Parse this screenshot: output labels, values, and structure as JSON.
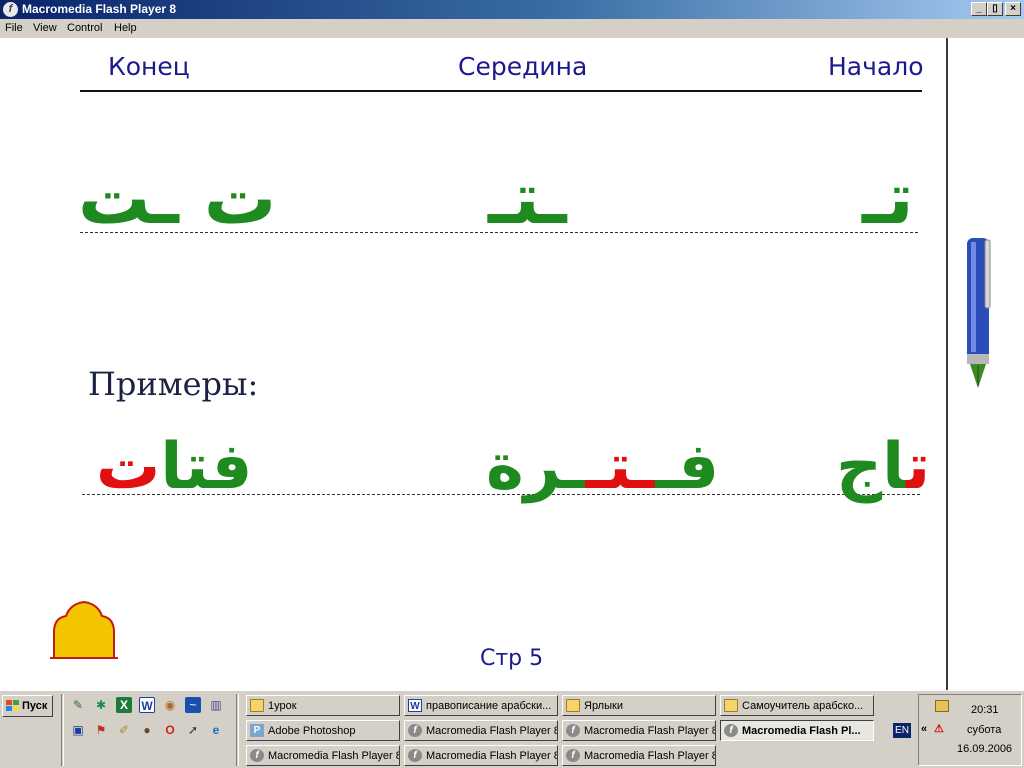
{
  "window": {
    "title": "Macromedia Flash Player 8",
    "app_icon": "flash-player-icon",
    "controls": {
      "minimize": "_",
      "maximize": "▯",
      "close": "×"
    }
  },
  "menu": {
    "items": [
      "File",
      "View",
      "Control",
      "Help"
    ]
  },
  "lesson": {
    "headers": {
      "end": "Конец",
      "middle": "Середина",
      "start": "Начало"
    },
    "letter_forms": {
      "end": "ت ـت",
      "middle": "ـتـ",
      "start": "تـ"
    },
    "examples_label": "Примеры:",
    "examples": {
      "left": {
        "red_part": "ت",
        "green_part": "فتا"
      },
      "middle": {
        "green_a": "فـ",
        "red_part": "ـتـ",
        "green_b": "ـرة"
      },
      "right": {
        "red_part": "ت",
        "green_part": "اج"
      }
    },
    "page": "Стр 5",
    "decor_icons": [
      "pen-icon",
      "mosque-arch-icon"
    ],
    "colors": {
      "heading": "#1a1a8e",
      "arabic_green": "#1f8a1f",
      "highlight_red": "#e01010"
    }
  },
  "taskbar": {
    "start_label": "Пуск",
    "quicklaunch_icons": [
      "pen-icon",
      "star-icon",
      "excel-icon",
      "word-icon",
      "explorer-icon",
      "chart-icon",
      "calculator-icon",
      "floppy-icon",
      "pdf-icon",
      "brush-icon",
      "ball-icon",
      "opera-icon",
      "cursor-icon",
      "ie-icon"
    ],
    "buttons": [
      {
        "label": "1урок",
        "icon": "folder-icon",
        "active": false
      },
      {
        "label": "правописание арабски...",
        "icon": "word-icon",
        "active": false
      },
      {
        "label": "Ярлыки",
        "icon": "folder-icon",
        "active": false
      },
      {
        "label": "Самоучитель арабско...",
        "icon": "folder-icon",
        "active": false
      },
      {
        "label": "Adobe Photoshop",
        "icon": "photoshop-icon",
        "active": false
      },
      {
        "label": "Macromedia Flash Player 8",
        "icon": "flash-icon",
        "active": false
      },
      {
        "label": "Macromedia Flash Player 8",
        "icon": "flash-icon",
        "active": false
      },
      {
        "label": "Macromedia Flash Pl...",
        "icon": "flash-icon",
        "active": true
      },
      {
        "label": "Macromedia Flash Player 8",
        "icon": "flash-icon",
        "active": false
      },
      {
        "label": "Macromedia Flash Player 8",
        "icon": "flash-icon",
        "active": false
      },
      {
        "label": "Macromedia Flash Player 8",
        "icon": "flash-icon",
        "active": false
      }
    ],
    "language": "EN",
    "tray_expand": "«",
    "clock": {
      "time": "20:31",
      "day": "субота",
      "date": "16.09.2006"
    }
  }
}
